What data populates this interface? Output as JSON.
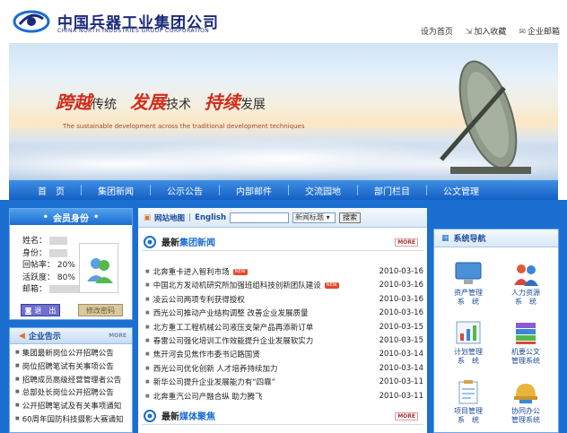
{
  "header": {
    "brand_cn": "中国兵器工业集团公司",
    "brand_en": "CHINA NORTH INDUSTRIES GROUP CORPORATION",
    "links": [
      "设为首页",
      "加入收藏",
      "企业邮箱"
    ]
  },
  "banner": {
    "slogan": [
      {
        "big": "跨越",
        "small": "传统"
      },
      {
        "big": "发展",
        "small": "技术"
      },
      {
        "big": "持续",
        "small": "发展"
      }
    ],
    "subslogan": "The sustainable development across the traditional development techniques"
  },
  "nav": [
    "首　页",
    "集团新闻",
    "公示公告",
    "内部邮件",
    "交流园地",
    "部门栏目",
    "公文管理"
  ],
  "member": {
    "title": "会员身份",
    "name_label": "姓名：",
    "id_label": "身份：",
    "online_label": "回帖率：",
    "online_value": "20%",
    "active_label": "活跃度：",
    "active_value": "80%",
    "email_label": "邮箱：",
    "exit_label": "退　出",
    "pwd_label": "修改密码"
  },
  "notice": {
    "title": "企业告示",
    "more": "MORE",
    "items": [
      "集团最新岗位公开招聘公告",
      "岗位招聘笔试有关事项公告",
      "招聘成员高级经营管理者公告",
      "总部处长岗位公开招聘公告",
      "公开招聘笔试及有关事项通知",
      "60周年国防科技摄影大赛通知"
    ]
  },
  "search": {
    "sitemap": "网站地图",
    "english": "English",
    "select_value": "新闻标题",
    "button": "搜索"
  },
  "news": {
    "title_a": "最新",
    "title_b": "集团新闻",
    "more": "MORE",
    "new_badge": "NEW",
    "items": [
      {
        "title": "北奔重卡进入智利市场",
        "date": "2010-03-16",
        "is_new": true
      },
      {
        "title": "中国北方发动机研究所加强班组科技创新团队建设",
        "date": "2010-03-16",
        "is_new": true
      },
      {
        "title": "凌云公司两项专利获得授权",
        "date": "2010-03-16",
        "is_new": false
      },
      {
        "title": "西光公司推动产业结构调整 改善企业发展质量",
        "date": "2010-03-16",
        "is_new": false
      },
      {
        "title": "北方重工工程机械公司液压支架产品再添新订单",
        "date": "2010-03-15",
        "is_new": false
      },
      {
        "title": "春雷公司强化培训工作效能提升企业发展软实力",
        "date": "2010-03-15",
        "is_new": false
      },
      {
        "title": "焦开河会见焦作市委书记路国贤",
        "date": "2010-03-14",
        "is_new": false
      },
      {
        "title": "西光公司优化创新 人才培养持续加力",
        "date": "2010-03-14",
        "is_new": false
      },
      {
        "title": "新华公司提升企业发展能力有“四靠”",
        "date": "2010-03-11",
        "is_new": false
      },
      {
        "title": "北奔重汽公司产融合纵 助力腾飞",
        "date": "2010-03-11",
        "is_new": false
      }
    ]
  },
  "media": {
    "title_a": "最新",
    "title_b": "媒体聚焦",
    "more": "MORE"
  },
  "sysnav": {
    "title": "系统导航",
    "items": [
      {
        "line1": "资产管理",
        "line2": "系　统",
        "icon": "monitor-icon"
      },
      {
        "line1": "人力资源",
        "line2": "系　统",
        "icon": "people-icon"
      },
      {
        "line1": "计划管理",
        "line2": "系　统",
        "icon": "chart-icon"
      },
      {
        "line1": "机要公文",
        "line2": "管理系统",
        "icon": "books-icon"
      },
      {
        "line1": "项目管理",
        "line2": "系　统",
        "icon": "clipboard-icon"
      },
      {
        "line1": "协同办公",
        "line2": "管理系统",
        "icon": "helmet-icon"
      }
    ]
  },
  "colors": {
    "nav_blue": "#1560c6",
    "accent_red": "#d12d1c",
    "brand_navy": "#1b2a7a"
  }
}
